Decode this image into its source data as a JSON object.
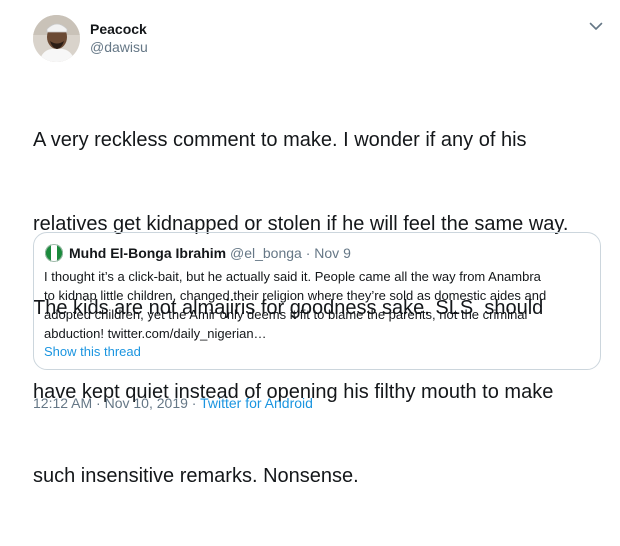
{
  "author": {
    "name": "Peacock",
    "handle": "@dawisu"
  },
  "tweet": {
    "text_lines": [
      "A very reckless comment to make. I wonder if any of his",
      "relatives get kidnapped or stolen if he will feel the same way.",
      "The kids are not almajiris for goodness sake. SLS  should",
      "have kept quiet instead of opening his filthy mouth to make",
      "such insensitive remarks. Nonsense."
    ]
  },
  "quoted_tweet": {
    "name": "Muhd El-Bonga Ibrahim",
    "handle": "@el_bonga",
    "separator": "·",
    "date": "Nov 9",
    "text_lines": [
      "I thought it’s a click-bait, but he actually said it. People came all the way from Anambra",
      "to kidnap little children, changed their religion where they’re sold as domestic aides and",
      "adopted children, yet the Amir only deems it fit to blame the parents, not the criminal",
      "abduction! twitter.com/daily_nigerian…"
    ],
    "show_thread": "Show this thread"
  },
  "meta": {
    "time": "12:12 AM",
    "separator": "·",
    "date": "Nov 10, 2019",
    "source": "Twitter for Android"
  },
  "icons": {
    "caret": "chevron-down-icon"
  },
  "colors": {
    "text": "#14171a",
    "secondary": "#657786",
    "link": "#1b95e0",
    "border": "#ccd6dd"
  }
}
